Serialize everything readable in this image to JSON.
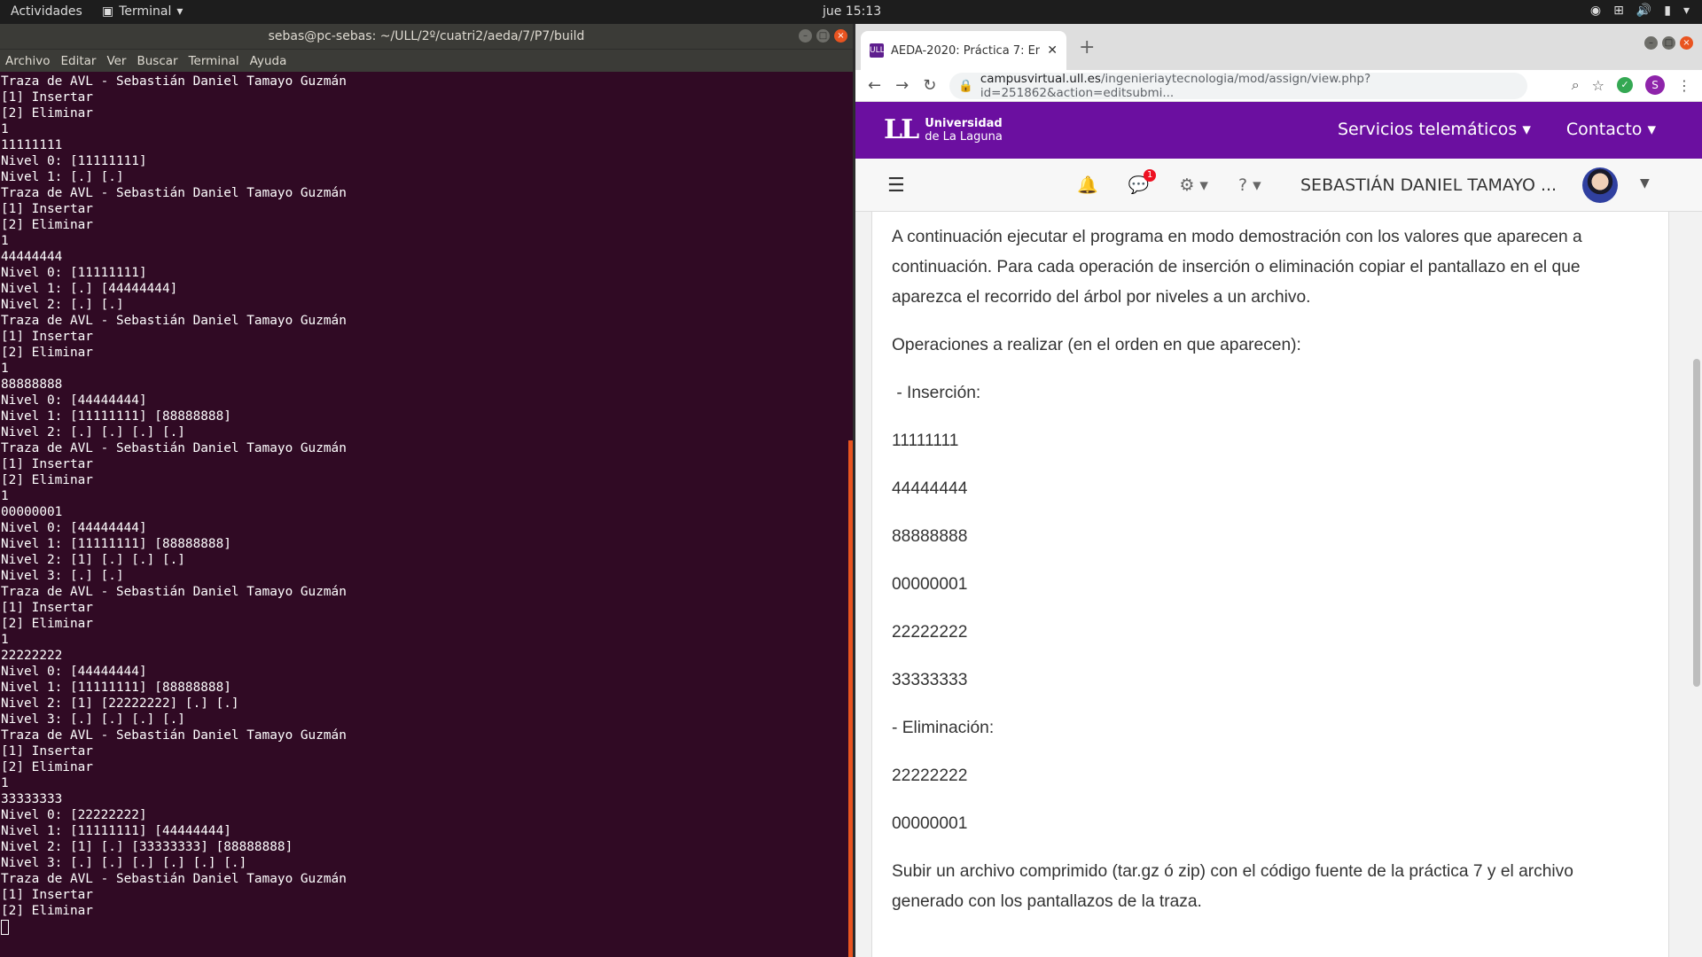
{
  "topbar": {
    "activities": "Actividades",
    "app_name": "Terminal",
    "clock": "jue 15:13"
  },
  "terminal": {
    "title": "sebas@pc-sebas: ~/ULL/2º/cuatri2/aeda/7/P7/build",
    "menu": [
      "Archivo",
      "Editar",
      "Ver",
      "Buscar",
      "Terminal",
      "Ayuda"
    ],
    "output": "Traza de AVL - Sebastián Daniel Tamayo Guzmán\n[1] Insertar\n[2] Eliminar\n1\n11111111\nNivel 0: [11111111]\nNivel 1: [.] [.]\nTraza de AVL - Sebastián Daniel Tamayo Guzmán\n[1] Insertar\n[2] Eliminar\n1\n44444444\nNivel 0: [11111111]\nNivel 1: [.] [44444444]\nNivel 2: [.] [.]\nTraza de AVL - Sebastián Daniel Tamayo Guzmán\n[1] Insertar\n[2] Eliminar\n1\n88888888\nNivel 0: [44444444]\nNivel 1: [11111111] [88888888]\nNivel 2: [.] [.] [.] [.]\nTraza de AVL - Sebastián Daniel Tamayo Guzmán\n[1] Insertar\n[2] Eliminar\n1\n00000001\nNivel 0: [44444444]\nNivel 1: [11111111] [88888888]\nNivel 2: [1] [.] [.] [.]\nNivel 3: [.] [.]\nTraza de AVL - Sebastián Daniel Tamayo Guzmán\n[1] Insertar\n[2] Eliminar\n1\n22222222\nNivel 0: [44444444]\nNivel 1: [11111111] [88888888]\nNivel 2: [1] [22222222] [.] [.]\nNivel 3: [.] [.] [.] [.]\nTraza de AVL - Sebastián Daniel Tamayo Guzmán\n[1] Insertar\n[2] Eliminar\n1\n33333333\nNivel 0: [22222222]\nNivel 1: [11111111] [44444444]\nNivel 2: [1] [.] [33333333] [88888888]\nNivel 3: [.] [.] [.] [.] [.] [.]\nTraza de AVL - Sebastián Daniel Tamayo Guzmán\n[1] Insertar\n[2] Eliminar\n"
  },
  "browser": {
    "tab_title": "AEDA-2020: Práctica 7: En",
    "favicon": "ULL",
    "url_host": "campusvirtual.ull.es",
    "url_path": "/ingenieriaytecnologia/mod/assign/view.php?id=251862&action=editsubmi...",
    "profile_letter": "S"
  },
  "site": {
    "logo_line1": "Universidad",
    "logo_line2": "de La Laguna",
    "menu_servicios": "Servicios telemáticos",
    "menu_contacto": "Contacto",
    "user_name": "SEBASTIÁN DANIEL TAMAYO ...",
    "messages_badge": "1"
  },
  "content": {
    "p1": "A continuación ejecutar el programa en modo demostración con los valores que aparecen a continuación. Para cada operación de inserción o eliminación copiar el pantallazo en el que aparezca el recorrido del árbol por niveles a un archivo.",
    "p2": "Operaciones a realizar (en el orden en que aparecen):",
    "p3": " - Inserción:",
    "ins1": "11111111",
    "ins2": "44444444",
    "ins3": "88888888",
    "ins4": "00000001",
    "ins5": "22222222",
    "ins6": "33333333",
    "p4": "- Eliminación:",
    "del1": "22222222",
    "del2": "00000001",
    "p5": "Subir un archivo comprimido (tar.gz ó zip) con el código fuente de la práctica 7 y el archivo generado con los pantallazos de la traza."
  }
}
